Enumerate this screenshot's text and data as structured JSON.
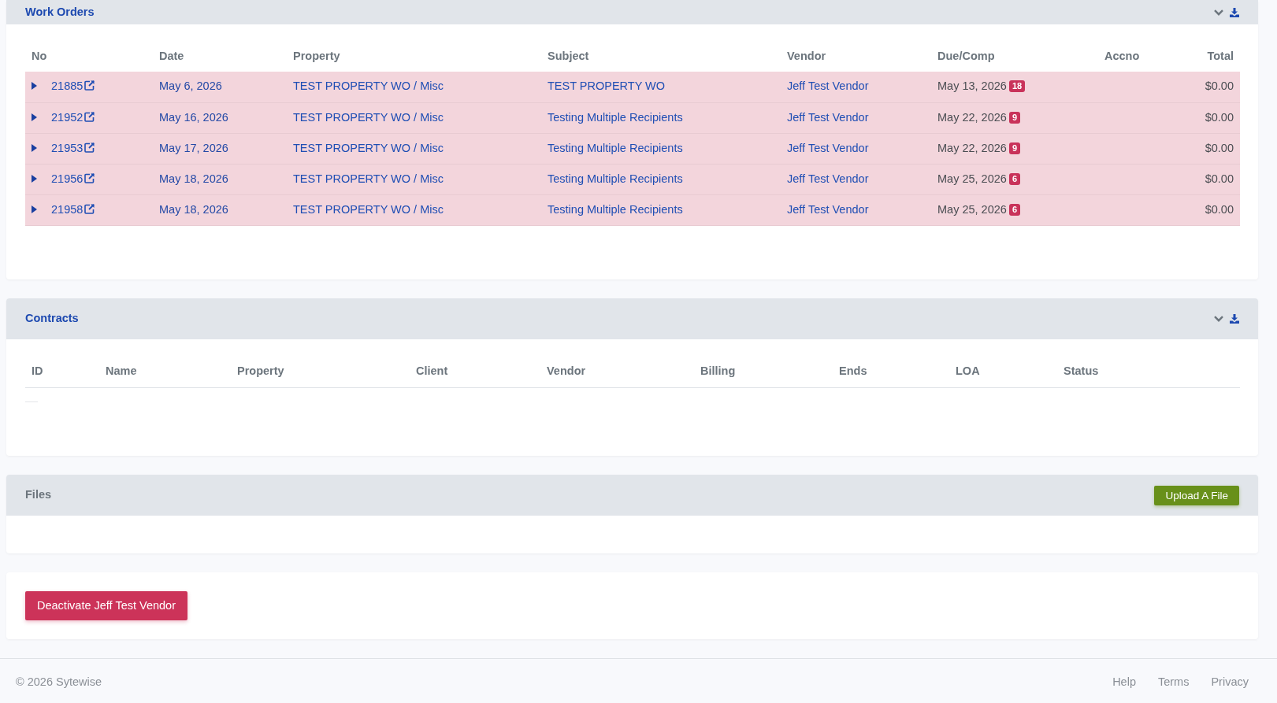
{
  "work_orders": {
    "title": "Work Orders",
    "collapsible": true,
    "downloadable": true,
    "columns": [
      "No",
      "Date",
      "Property",
      "Subject",
      "Vendor",
      "Due/Comp",
      "Accno",
      "Total"
    ],
    "rows": [
      {
        "no": "21885",
        "expanded": false,
        "overdue": true,
        "date": "May 6, 2026",
        "property": "TEST PROPERTY WO / Misc",
        "subject": "TEST PROPERTY WO",
        "vendor": "Jeff Test Vendor",
        "due": "May 13, 2026",
        "days_badge": "18",
        "total": "$0.00"
      },
      {
        "no": "21952",
        "expanded": false,
        "overdue": true,
        "date": "May 16, 2026",
        "property": "TEST PROPERTY WO / Misc",
        "subject": "Testing Multiple Recipients",
        "vendor": "Jeff Test Vendor",
        "due": "May 22, 2026",
        "days_badge": "9",
        "total": "$0.00"
      },
      {
        "no": "21953",
        "expanded": false,
        "overdue": true,
        "date": "May 17, 2026",
        "property": "TEST PROPERTY WO / Misc",
        "subject": "Testing Multiple Recipients",
        "vendor": "Jeff Test Vendor",
        "due": "May 22, 2026",
        "days_badge": "9",
        "total": "$0.00"
      },
      {
        "no": "21956",
        "expanded": false,
        "overdue": true,
        "date": "May 18, 2026",
        "property": "TEST PROPERTY WO / Misc",
        "subject": "Testing Multiple Recipients",
        "vendor": "Jeff Test Vendor",
        "due": "May 25, 2026",
        "days_badge": "6",
        "total": "$0.00"
      },
      {
        "no": "21958",
        "expanded": false,
        "overdue": true,
        "date": "May 18, 2026",
        "property": "TEST PROPERTY WO / Misc",
        "subject": "Testing Multiple Recipients",
        "vendor": "Jeff Test Vendor",
        "due": "May 25, 2026",
        "days_badge": "6",
        "total": "$0.00"
      }
    ]
  },
  "contracts": {
    "title": "Contracts",
    "collapsible": true,
    "downloadable": true,
    "columns": [
      "ID",
      "Name",
      "Property",
      "Client",
      "Vendor",
      "Billing",
      "Ends",
      "LOA",
      "Status"
    ]
  },
  "files": {
    "title": "Files",
    "collapsible": false,
    "upload_button": "Upload A File"
  },
  "deactivate_button": "Deactivate Jeff Test Vendor",
  "footer": {
    "copyright": "© 2026 Sytewise",
    "links": [
      "Help",
      "Terms",
      "Privacy"
    ]
  }
}
